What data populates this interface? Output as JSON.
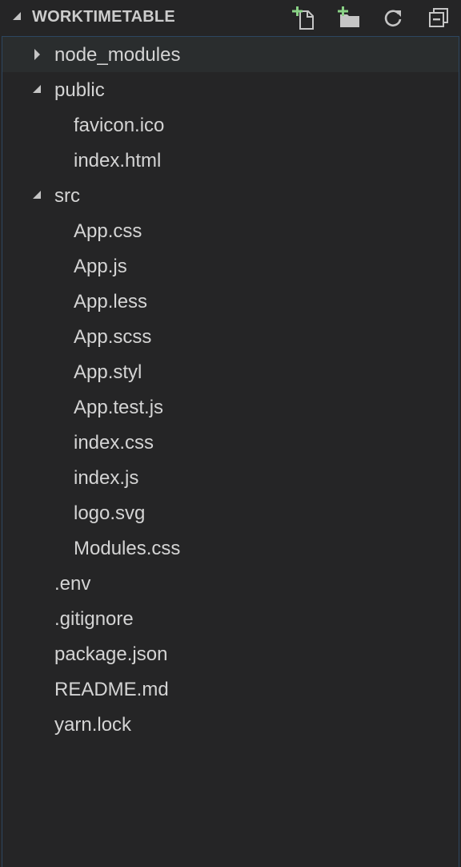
{
  "header": {
    "title": "WORKTIMETABLE",
    "actions": [
      {
        "name": "new-file",
        "icon": "new-file-icon"
      },
      {
        "name": "new-folder",
        "icon": "new-folder-icon"
      },
      {
        "name": "refresh",
        "icon": "refresh-icon"
      },
      {
        "name": "collapse-all",
        "icon": "collapse-all-icon"
      }
    ]
  },
  "tree": {
    "items": [
      {
        "label": "node_modules",
        "type": "folder",
        "expanded": false
      },
      {
        "label": "public",
        "type": "folder",
        "expanded": true
      },
      {
        "label": "favicon.ico",
        "type": "file"
      },
      {
        "label": "index.html",
        "type": "file"
      },
      {
        "label": "src",
        "type": "folder",
        "expanded": true
      },
      {
        "label": "App.css",
        "type": "file"
      },
      {
        "label": "App.js",
        "type": "file"
      },
      {
        "label": "App.less",
        "type": "file"
      },
      {
        "label": "App.scss",
        "type": "file"
      },
      {
        "label": "App.styl",
        "type": "file"
      },
      {
        "label": "App.test.js",
        "type": "file"
      },
      {
        "label": "index.css",
        "type": "file"
      },
      {
        "label": "index.js",
        "type": "file"
      },
      {
        "label": "logo.svg",
        "type": "file"
      },
      {
        "label": "Modules.css",
        "type": "file"
      },
      {
        "label": ".env",
        "type": "file"
      },
      {
        "label": ".gitignore",
        "type": "file"
      },
      {
        "label": "package.json",
        "type": "file"
      },
      {
        "label": "README.md",
        "type": "file"
      },
      {
        "label": "yarn.lock",
        "type": "file"
      }
    ]
  },
  "colors": {
    "background": "#252526",
    "text": "#d4d4d4",
    "focus_border": "#2d4660",
    "icon": "#c5c5c5",
    "icon_add": "#89d185"
  }
}
